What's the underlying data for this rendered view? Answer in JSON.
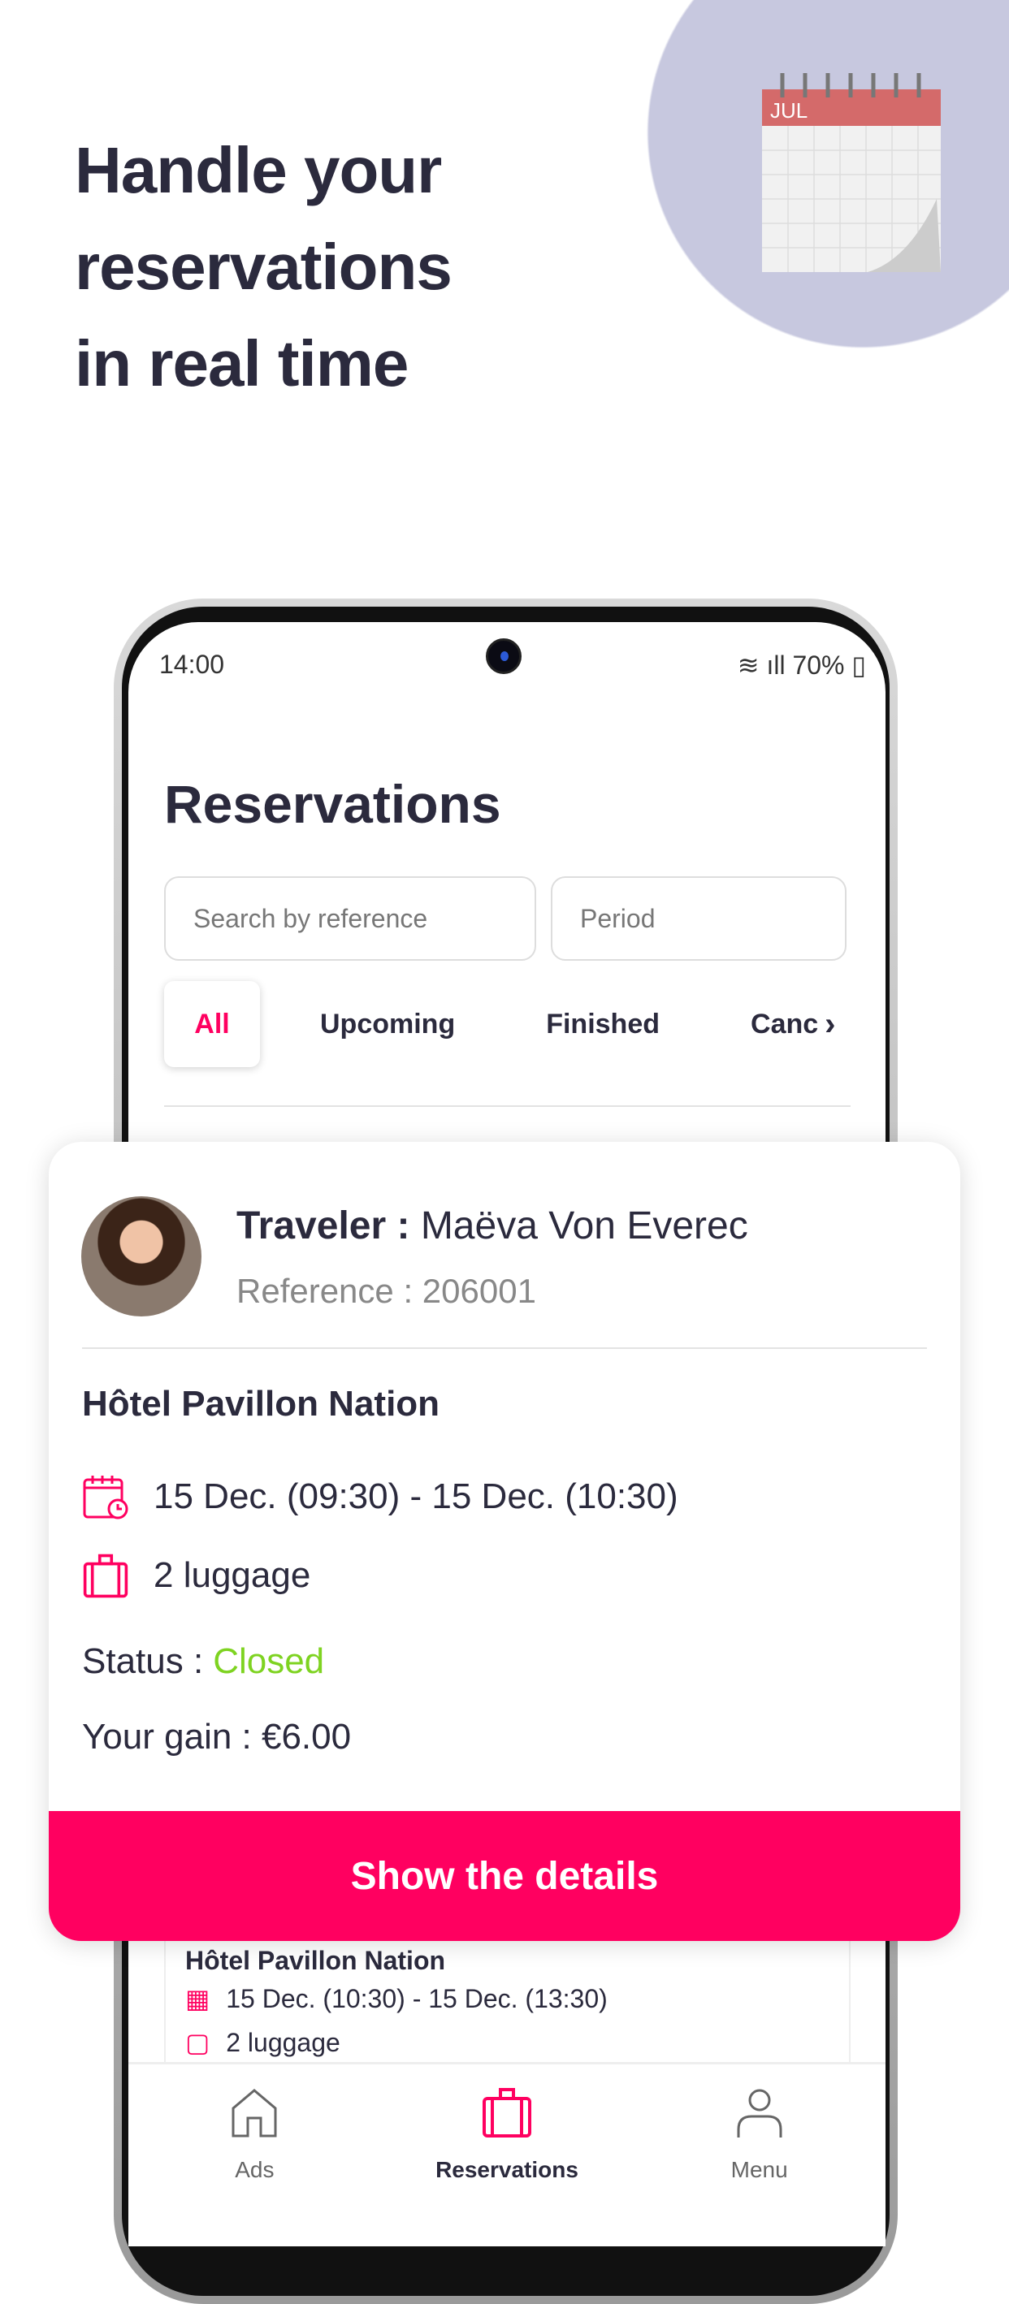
{
  "promo": {
    "headline_lines": [
      "Handle your",
      "reservations",
      "in real time"
    ],
    "calendar_month": "JUL"
  },
  "status_bar": {
    "time": "14:00",
    "battery": "70%"
  },
  "page": {
    "title": "Reservations"
  },
  "search": {
    "placeholder": "Search by reference",
    "period_placeholder": "Period"
  },
  "tabs": [
    {
      "label": "All",
      "active": true
    },
    {
      "label": "Upcoming"
    },
    {
      "label": "Finished"
    },
    {
      "label": "Canc"
    }
  ],
  "card": {
    "traveler_label": "Traveler :",
    "traveler_name": "Maëva Von Everec",
    "reference": "Reference : 206001",
    "hotel": "Hôtel Pavillon Nation",
    "dates": "15 Dec. (09:30) - 15 Dec. (10:30)",
    "luggage": "2 luggage",
    "status_label": "Status :",
    "status_value": "Closed",
    "gain": "Your gain : €6.00",
    "button": "Show the details"
  },
  "background_card": {
    "hotel": "Hôtel Pavillon Nation",
    "dates": "15 Dec. (10:30) - 15 Dec. (13:30)",
    "luggage": "2 luggage"
  },
  "nav": [
    {
      "label": "Ads",
      "icon": "home-icon"
    },
    {
      "label": "Reservations",
      "icon": "suitcase-icon",
      "active": true
    },
    {
      "label": "Menu",
      "icon": "user-icon"
    }
  ],
  "colors": {
    "accent": "#ff0060",
    "status_closed": "#7ed321",
    "text": "#2b2a3d",
    "circle": "#c7c8df"
  }
}
